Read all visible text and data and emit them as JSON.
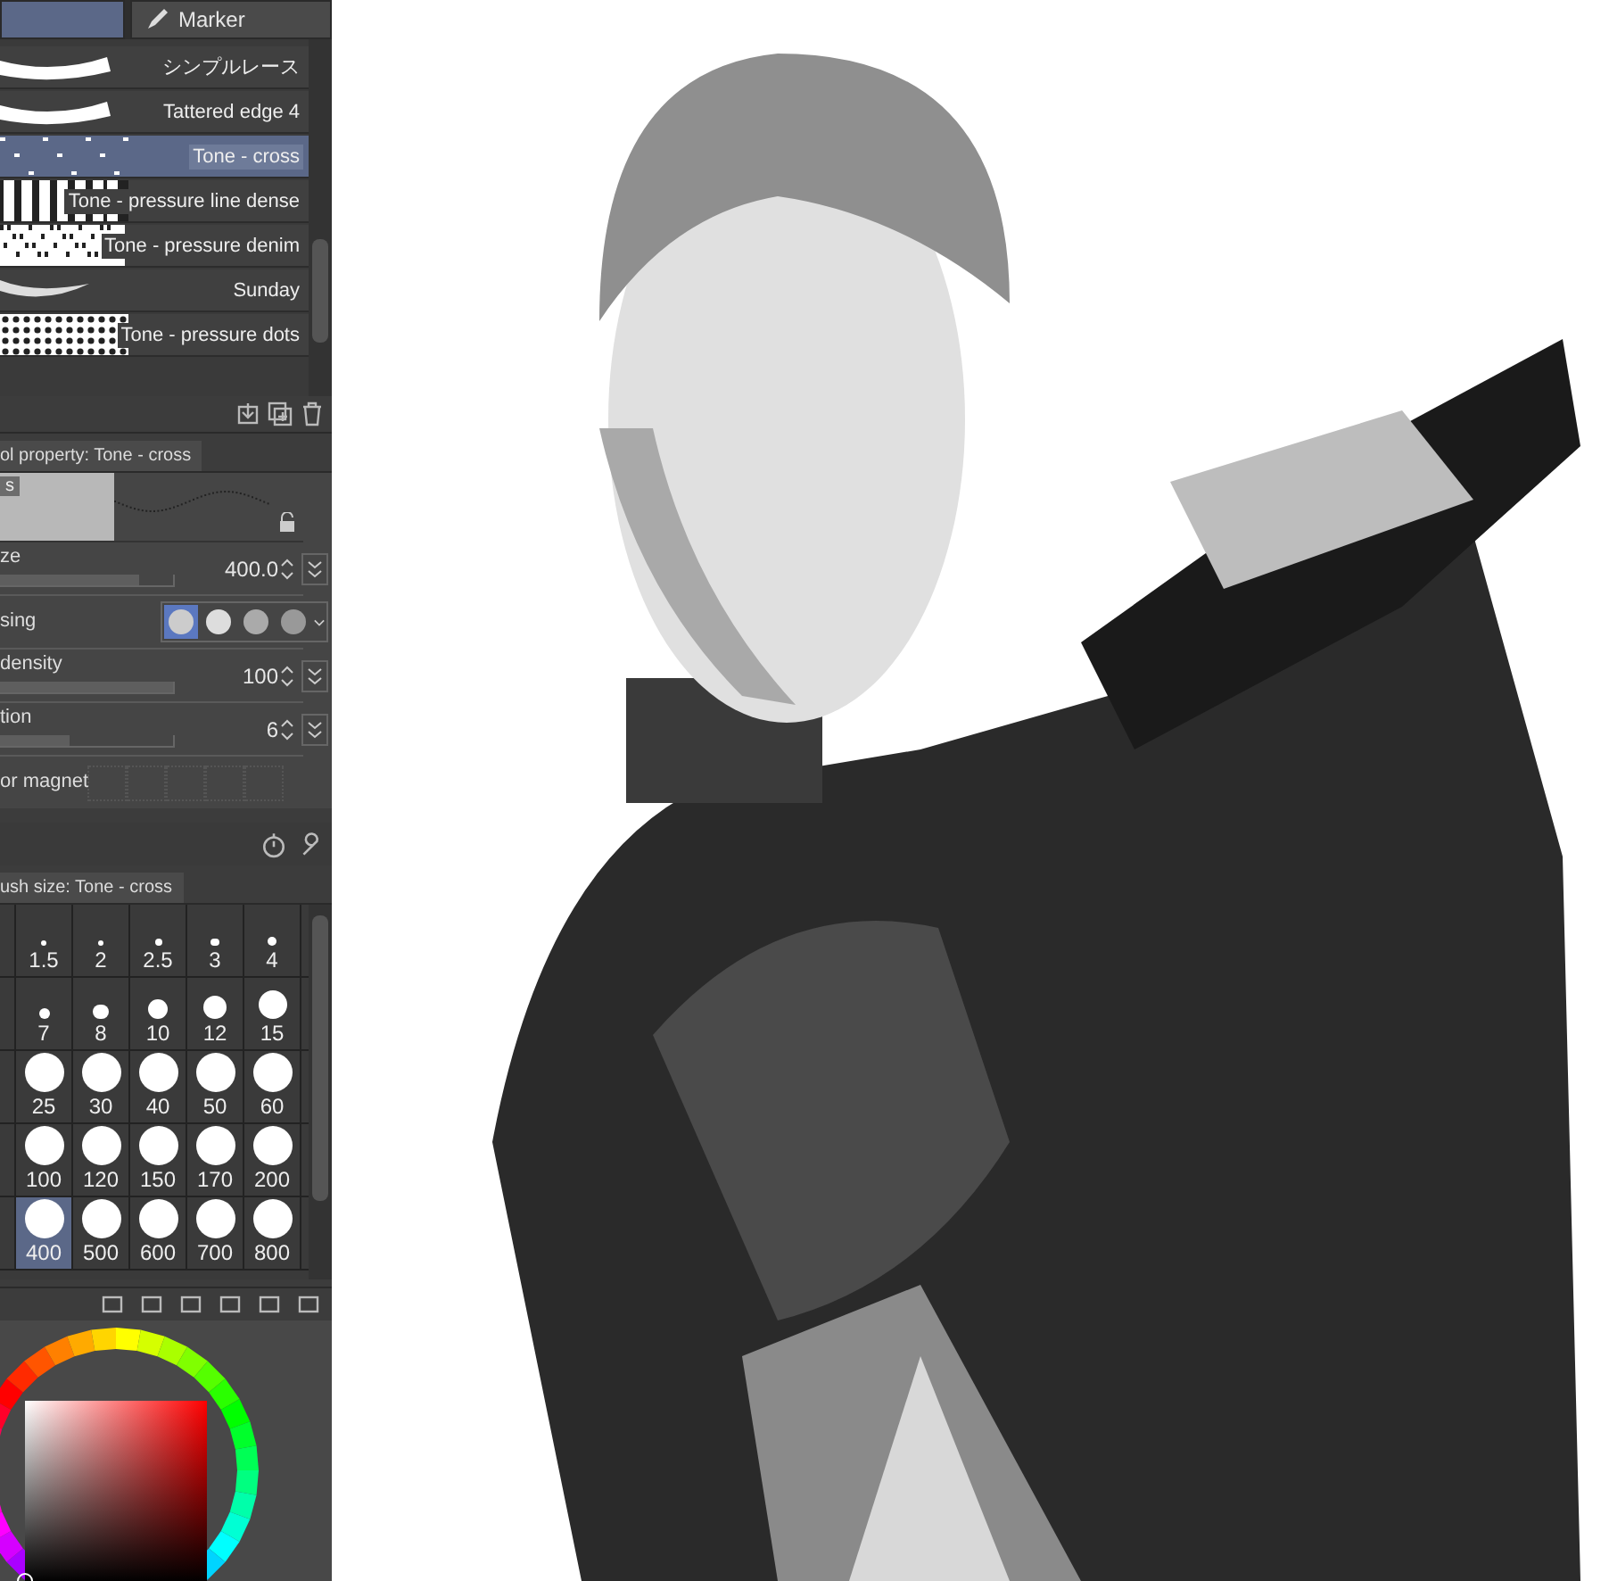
{
  "top_tabs": [
    {
      "selected": true
    },
    {
      "label": "Marker",
      "selected": false
    }
  ],
  "brushes": [
    {
      "name": "シンプルレース",
      "selected": false,
      "kind": "lace"
    },
    {
      "name": "Tattered edge 4",
      "selected": false,
      "kind": "lace"
    },
    {
      "name": "Tone - cross",
      "selected": true,
      "kind": "cross"
    },
    {
      "name": "Tone - pressure line dense",
      "selected": false,
      "kind": "lines"
    },
    {
      "name": "Tone - pressure denim",
      "selected": false,
      "kind": "denim"
    },
    {
      "name": "Sunday",
      "selected": false,
      "kind": "swoosh"
    },
    {
      "name": "Tone - pressure dots",
      "selected": false,
      "kind": "dots"
    }
  ],
  "tool_property": {
    "tab": "ol property: Tone - cross",
    "preview_label": "s",
    "rows": [
      {
        "kind": "slider",
        "label": "ze",
        "value": "400.0",
        "level": 0.8
      },
      {
        "kind": "hardness",
        "label": "sing",
        "options": [
          {
            "selected": true
          },
          {
            "selected": false
          },
          {
            "selected": false
          },
          {
            "selected": false
          }
        ]
      },
      {
        "kind": "slider",
        "label": "density",
        "value": "100",
        "level": 1.0
      },
      {
        "kind": "slider",
        "label": "tion",
        "value": "6",
        "level": 0.4
      },
      {
        "kind": "magnet",
        "label": "or magnet"
      }
    ]
  },
  "brush_size": {
    "tab": "ush size: Tone - cross",
    "rows": [
      [
        {
          "size": "1.5",
          "selected": false
        },
        {
          "size": "2",
          "selected": false
        },
        {
          "size": "2.5",
          "selected": false
        },
        {
          "size": "3",
          "selected": false
        },
        {
          "size": "4",
          "selected": false
        }
      ],
      [
        {
          "size": "7",
          "selected": false
        },
        {
          "size": "8",
          "selected": false
        },
        {
          "size": "10",
          "selected": false
        },
        {
          "size": "12",
          "selected": false
        },
        {
          "size": "15",
          "selected": false
        }
      ],
      [
        {
          "size": "25",
          "selected": false
        },
        {
          "size": "30",
          "selected": false
        },
        {
          "size": "40",
          "selected": false
        },
        {
          "size": "50",
          "selected": false
        },
        {
          "size": "60",
          "selected": false
        }
      ],
      [
        {
          "size": "100",
          "selected": false
        },
        {
          "size": "120",
          "selected": false
        },
        {
          "size": "150",
          "selected": false
        },
        {
          "size": "170",
          "selected": false
        },
        {
          "size": "200",
          "selected": false
        }
      ],
      [
        {
          "size": "400",
          "selected": true
        },
        {
          "size": "500",
          "selected": false
        },
        {
          "size": "600",
          "selected": false
        },
        {
          "size": "700",
          "selected": false
        },
        {
          "size": "800",
          "selected": false
        }
      ]
    ]
  }
}
